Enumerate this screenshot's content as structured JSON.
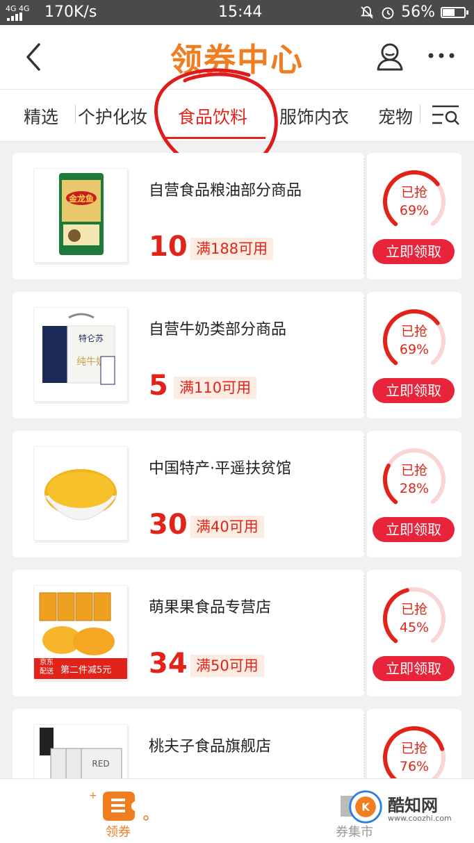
{
  "status_bar": {
    "signal": "4G 4G",
    "speed": "170K/s",
    "time": "15:44",
    "battery": "56%",
    "battery_level": 0.56
  },
  "header": {
    "title": "领券中心",
    "back_icon": "chevron-left-icon",
    "user_icon": "user-icon",
    "more_icon": "more-dots-icon"
  },
  "tabs": {
    "items": [
      "精选",
      "个护化妆",
      "食品饮料",
      "服饰内衣",
      "宠物"
    ],
    "active_index": 2,
    "filter_icon": "filter-list-icon"
  },
  "colors": {
    "accent": "#e2231a",
    "brand_orange": "#f07d1f",
    "button": "#e8243a",
    "ring_track": "#fbd4d4"
  },
  "coupons": [
    {
      "shop": "自营食品粮油部分商品",
      "amount": "10",
      "condition": "满188可用",
      "claimed_label": "已抢",
      "claimed_pct": "69%",
      "claimed_value": 69,
      "button": "立即领取",
      "image": "rice-bag-image"
    },
    {
      "shop": "自营牛奶类部分商品",
      "amount": "5",
      "condition": "满110可用",
      "claimed_label": "已抢",
      "claimed_pct": "69%",
      "claimed_value": 69,
      "button": "立即领取",
      "image": "milk-box-image"
    },
    {
      "shop": "中国特产·平遥扶贫馆",
      "amount": "30",
      "condition": "满40可用",
      "claimed_label": "已抢",
      "claimed_pct": "28%",
      "claimed_value": 28,
      "button": "立即领取",
      "image": "millet-bowl-image"
    },
    {
      "shop": "萌果果食品专营店",
      "amount": "34",
      "condition": "满50可用",
      "claimed_label": "已抢",
      "claimed_pct": "45%",
      "claimed_value": 45,
      "button": "立即领取",
      "image": "canned-peach-image",
      "image_tag_left": "京东\n配送",
      "image_tag_right": "第二件减5元"
    },
    {
      "shop": "桃夫子食品旗舰店",
      "amount": "",
      "condition": "",
      "claimed_label": "已抢",
      "claimed_pct": "76%",
      "claimed_value": 76,
      "button": "",
      "image": "bayberry-can-image"
    }
  ],
  "bottom_nav": {
    "items": [
      {
        "label": "领券",
        "icon": "coupon-icon"
      },
      {
        "label": "券集市",
        "icon": "coupon-market-icon"
      }
    ],
    "watermark": "酷知网",
    "watermark_url": "www.coozhi.com"
  }
}
